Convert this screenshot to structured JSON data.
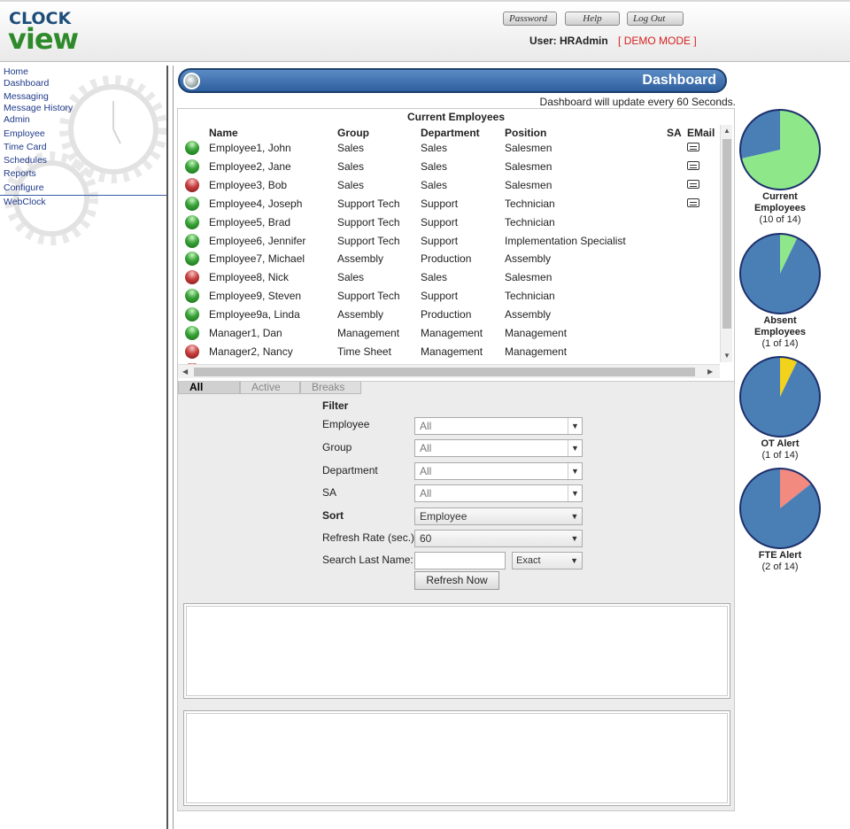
{
  "header": {
    "logo_top": "CLOCK",
    "logo_bottom": "view",
    "buttons": [
      "Password",
      "Help",
      "Log Out"
    ],
    "user_label": "User: HRAdmin",
    "mode": "[ DEMO MODE ]"
  },
  "sidebar": {
    "items": [
      "Home",
      "Dashboard",
      "Messaging",
      "Message History",
      "Admin",
      "Employee",
      "Time Card",
      "Schedules",
      "Reports",
      "Configure",
      "WebClock"
    ]
  },
  "dashboard": {
    "title": "Dashboard",
    "update_note": "Dashboard will update every 60 Seconds.",
    "table_title": "Current Employees",
    "columns": [
      "Name",
      "Group",
      "Department",
      "Position",
      "SA",
      "EMail"
    ],
    "rows": [
      {
        "status": "green",
        "name": "Employee1, John",
        "group": "Sales",
        "department": "Sales",
        "position": "Salesmen",
        "email": true
      },
      {
        "status": "green",
        "name": "Employee2, Jane",
        "group": "Sales",
        "department": "Sales",
        "position": "Salesmen",
        "email": true
      },
      {
        "status": "red",
        "name": "Employee3, Bob",
        "group": "Sales",
        "department": "Sales",
        "position": "Salesmen",
        "email": true
      },
      {
        "status": "green",
        "name": "Employee4, Joseph",
        "group": "Support Tech",
        "department": "Support",
        "position": "Technician",
        "email": true
      },
      {
        "status": "green",
        "name": "Employee5, Brad",
        "group": "Support Tech",
        "department": "Support",
        "position": "Technician",
        "email": false
      },
      {
        "status": "green",
        "name": "Employee6, Jennifer",
        "group": "Support Tech",
        "department": "Support",
        "position": "Implementation Specialist",
        "email": false
      },
      {
        "status": "green",
        "name": "Employee7, Michael",
        "group": "Assembly",
        "department": "Production",
        "position": "Assembly",
        "email": false
      },
      {
        "status": "red",
        "name": "Employee8, Nick",
        "group": "Sales",
        "department": "Sales",
        "position": "Salesmen",
        "email": false
      },
      {
        "status": "green",
        "name": "Employee9, Steven",
        "group": "Support Tech",
        "department": "Support",
        "position": "Technician",
        "email": false
      },
      {
        "status": "green",
        "name": "Employee9a, Linda",
        "group": "Assembly",
        "department": "Production",
        "position": "Assembly",
        "email": false
      },
      {
        "status": "green",
        "name": "Manager1, Dan",
        "group": "Management",
        "department": "Management",
        "position": "Management",
        "email": false
      },
      {
        "status": "red",
        "name": "Manager2, Nancy",
        "group": "Time Sheet",
        "department": "Management",
        "position": "Management",
        "email": false
      }
    ],
    "tabs": [
      "All",
      "Active",
      "Breaks"
    ],
    "active_tab": "All",
    "filter": {
      "heading": "Filter",
      "employee_label": "Employee",
      "employee_value": "All",
      "group_label": "Group",
      "group_value": "All",
      "department_label": "Department",
      "department_value": "All",
      "sa_label": "SA",
      "sa_value": "All",
      "sort_label": "Sort",
      "sort_value": "Employee",
      "refresh_label": "Refresh Rate (sec.)",
      "refresh_value": "60",
      "search_label": "Search Last Name:",
      "search_value": "",
      "match_value": "Exact",
      "refresh_button": "Refresh Now"
    }
  },
  "chart_data": [
    {
      "type": "pie",
      "title": "Current Employees",
      "caption": "(10 of 14)",
      "slices": [
        {
          "label": "highlighted",
          "value": 10
        },
        {
          "label": "rest",
          "value": 4
        }
      ],
      "colors": [
        "#8ee88a",
        "#4a7fb5"
      ]
    },
    {
      "type": "pie",
      "title": "Absent Employees",
      "caption": "(1 of 14)",
      "slices": [
        {
          "label": "highlighted",
          "value": 1
        },
        {
          "label": "rest",
          "value": 13
        }
      ],
      "colors": [
        "#8ee88a",
        "#4a7fb5"
      ]
    },
    {
      "type": "pie",
      "title": "OT Alert",
      "caption": "(1 of 14)",
      "slices": [
        {
          "label": "highlighted",
          "value": 1
        },
        {
          "label": "rest",
          "value": 13
        }
      ],
      "colors": [
        "#f2d21a",
        "#4a7fb5"
      ]
    },
    {
      "type": "pie",
      "title": "FTE Alert",
      "caption": "(2 of 14)",
      "slices": [
        {
          "label": "highlighted",
          "value": 2
        },
        {
          "label": "rest",
          "value": 12
        }
      ],
      "colors": [
        "#f28a80",
        "#4a7fb5"
      ]
    }
  ]
}
